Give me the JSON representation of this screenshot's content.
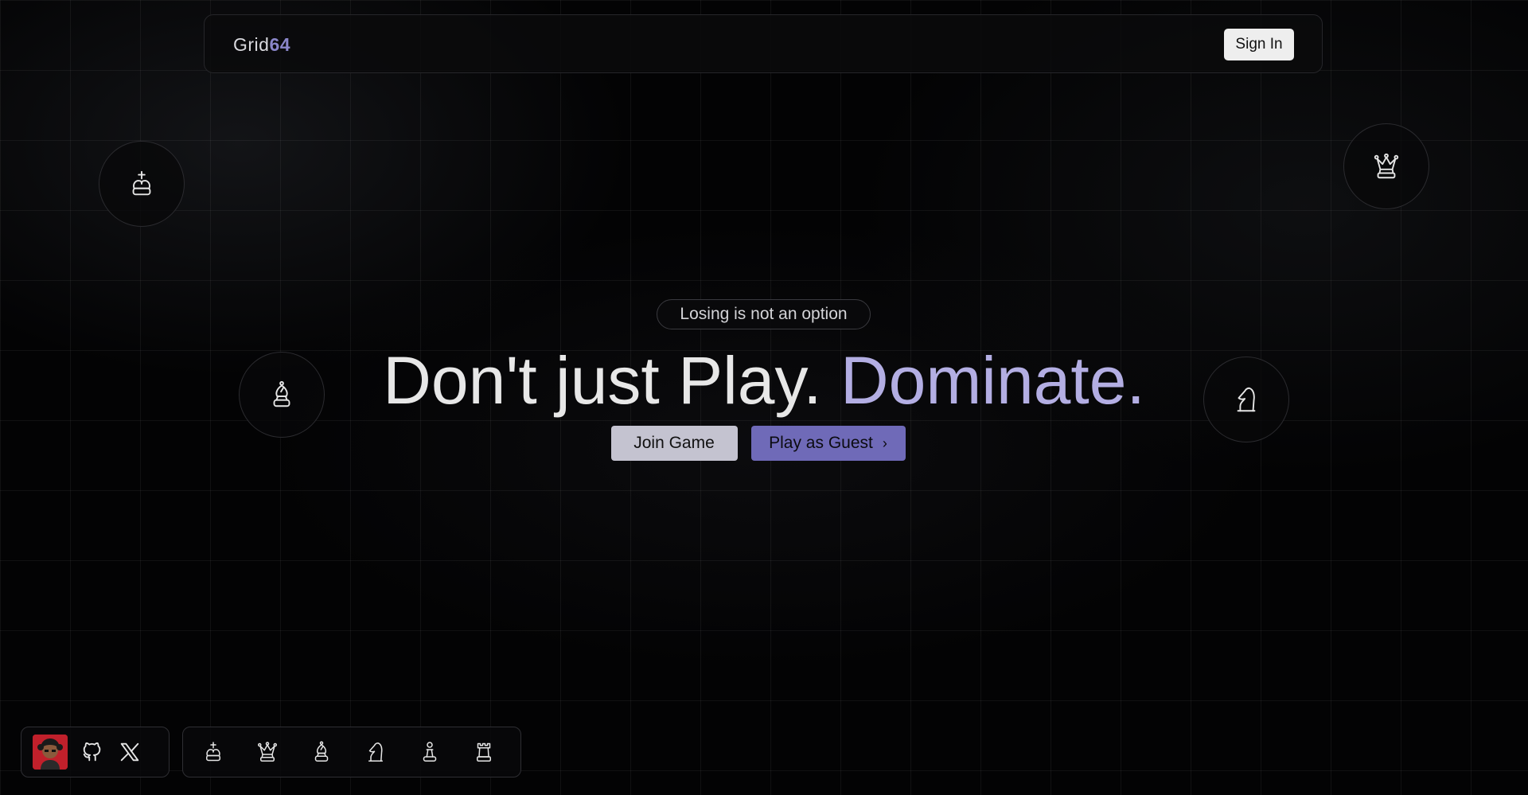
{
  "header": {
    "logo_text": "Grid",
    "logo_accent": "64",
    "signin_label": "Sign In"
  },
  "floating_pieces": [
    "king-icon",
    "queen-icon",
    "bishop-icon",
    "knight-icon"
  ],
  "hero": {
    "tagline": "Losing is not an option",
    "headline_main": "Don't just Play.",
    "headline_accent": "Dominate.",
    "join_label": "Join Game",
    "guest_label": "Play as Guest",
    "guest_icon": "chevron-right-icon"
  },
  "dock_social": [
    "avatar",
    "github-icon",
    "x-icon"
  ],
  "dock_pieces": [
    "king-icon",
    "queen-icon",
    "bishop-icon",
    "knight-icon",
    "pawn-icon",
    "rook-icon"
  ],
  "colors": {
    "accent": "#8a86c9",
    "headline_accent": "#b3aee3",
    "guest_button": "#6f6ab8",
    "join_button": "#c4c3d0",
    "background": "#030304"
  }
}
